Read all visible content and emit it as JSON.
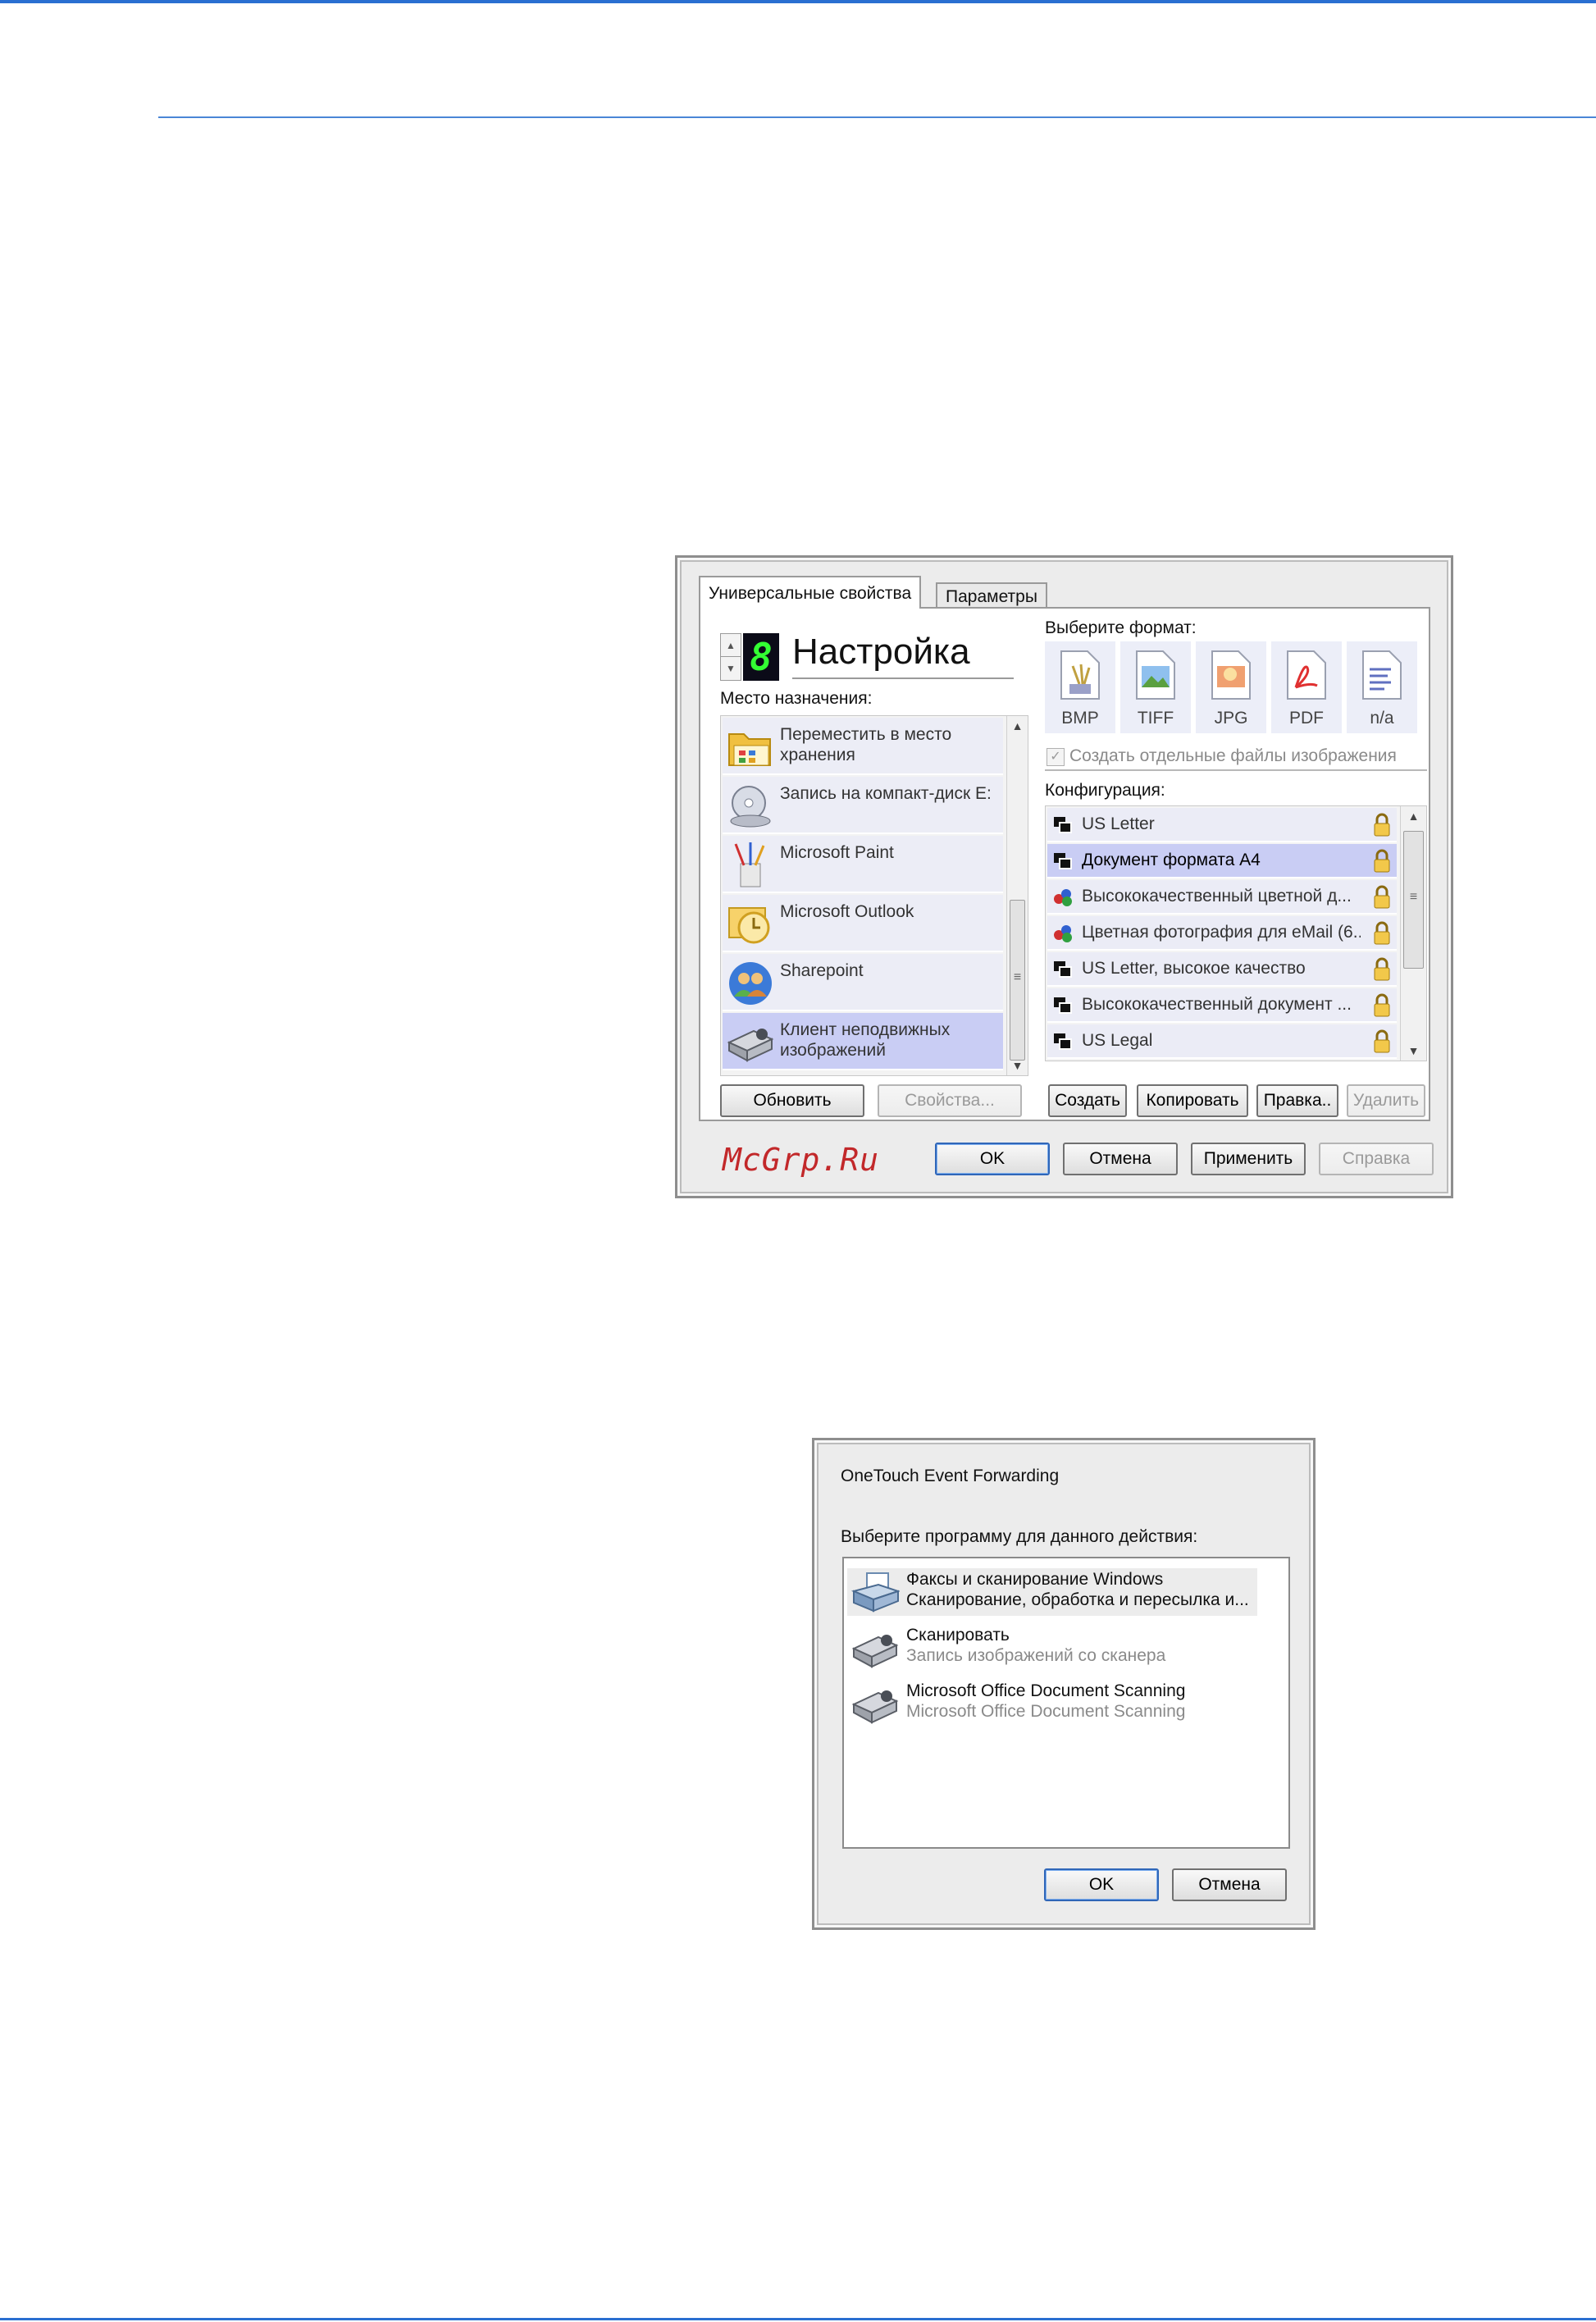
{
  "dialog1": {
    "tabs": [
      "Универсальные свойства",
      "Параметры"
    ],
    "profile_number": "8",
    "profile_name": "Настройка",
    "destination_label": "Место назначения:",
    "destinations": [
      {
        "label": "Переместить в место хранения",
        "icon": "folder-storage-icon"
      },
      {
        "label": "Запись на компакт-диск E:",
        "icon": "cd-burn-icon"
      },
      {
        "label": "Microsoft Paint",
        "icon": "paint-icon"
      },
      {
        "label": "Microsoft Outlook",
        "icon": "outlook-icon"
      },
      {
        "label": "Sharepoint",
        "icon": "sharepoint-icon"
      },
      {
        "label": "Клиент неподвижных изображений",
        "icon": "scanner-icon",
        "selected": true
      }
    ],
    "format_label": "Выберите формат:",
    "formats": [
      "BMP",
      "TIFF",
      "JPG",
      "PDF",
      "n/a"
    ],
    "separate_files_label": "Создать отдельные файлы изображения",
    "config_label": "Конфигурация:",
    "configs": [
      {
        "label": "US Letter",
        "icon": "bw-config-icon"
      },
      {
        "label": "Документ формата А4",
        "icon": "bw-config-icon",
        "selected": true
      },
      {
        "label": "Высококачественный цветной д...",
        "icon": "color-config-icon"
      },
      {
        "label": "Цветная фотография для eMail (6...",
        "icon": "color-config-icon"
      },
      {
        "label": "US Letter, высокое качество",
        "icon": "bw-config-icon"
      },
      {
        "label": "Высококачественный документ ...",
        "icon": "bw-config-icon"
      },
      {
        "label": "US Legal",
        "icon": "bw-config-icon"
      }
    ],
    "left_buttons": {
      "refresh": "Обновить",
      "properties": "Свойства..."
    },
    "config_buttons": {
      "create": "Создать",
      "copy": "Копировать",
      "edit": "Правка..",
      "delete": "Удалить"
    },
    "bottom_buttons": {
      "ok": "OK",
      "cancel": "Отмена",
      "apply": "Применить",
      "help": "Справка"
    },
    "watermark": "McGrp.Ru"
  },
  "dialog2": {
    "title": "OneTouch Event Forwarding",
    "prompt": "Выберите программу для данного действия:",
    "programs": [
      {
        "title": "Факсы и сканирование Windows",
        "subtitle": "Сканирование, обработка и пересылка и...",
        "icon": "fax-scanner-icon",
        "selected": true
      },
      {
        "title": "Сканировать",
        "subtitle": "Запись изображений со сканера",
        "icon": "scanner-icon"
      },
      {
        "title": "Microsoft Office Document Scanning",
        "subtitle": "Microsoft Office Document Scanning",
        "icon": "scanner-icon"
      }
    ],
    "ok": "OK",
    "cancel": "Отмена"
  }
}
